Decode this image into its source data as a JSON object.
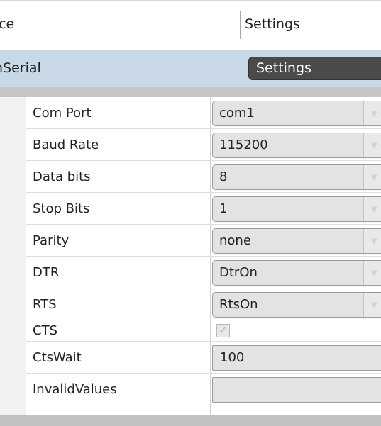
{
  "header": {
    "left_column": "ce",
    "right_column": "Settings"
  },
  "device": {
    "name": "nSerial",
    "settings_button": "Settings"
  },
  "properties": [
    {
      "label": "Com Port",
      "value": "com1",
      "control": "dropdown",
      "icon": "chevron-down-icon"
    },
    {
      "label": "Baud Rate",
      "value": "115200",
      "control": "dropdown",
      "icon": "chevron-down-icon"
    },
    {
      "label": "Data bits",
      "value": "8",
      "control": "dropdown",
      "icon": "chevron-down-icon"
    },
    {
      "label": "Stop Bits",
      "value": "1",
      "control": "dropdown",
      "icon": "chevron-down-icon"
    },
    {
      "label": "Parity",
      "value": "none",
      "control": "dropdown",
      "icon": "chevron-down-icon"
    },
    {
      "label": "DTR",
      "value": "DtrOn",
      "control": "dropdown",
      "icon": "chevron-down-icon"
    },
    {
      "label": "RTS",
      "value": "RtsOn",
      "control": "dropdown",
      "icon": "chevron-down-icon"
    },
    {
      "label": "CTS",
      "checked": true,
      "control": "checkbox",
      "icon": "checkmark-icon"
    },
    {
      "label": "CtsWait",
      "value": "100",
      "control": "textbox"
    },
    {
      "label": "InvalidValues",
      "value": "",
      "control": "textbox"
    }
  ],
  "icons": {
    "dropdown_arrow": "chevron-down-icon",
    "checkbox_mark": "checkmark-icon"
  },
  "colors": {
    "device_row_bg": "#c9d8e7",
    "settings_button_bg": "#4a4a4a",
    "separator_band": "#c6c6c6",
    "control_bg": "#e3e3e3"
  }
}
